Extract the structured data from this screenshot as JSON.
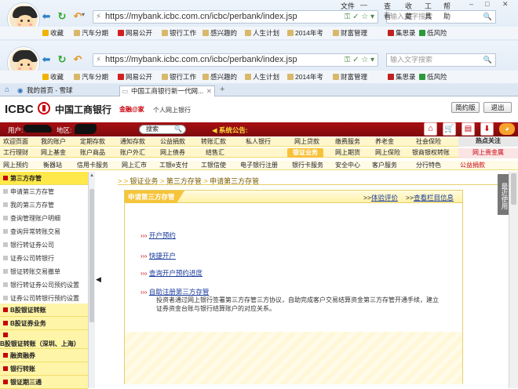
{
  "browser": {
    "url": "https://mybank.icbc.com.cn/icbc/perbank/index.jsp",
    "search_placeholder": "输入文字搜索",
    "menu": [
      "文件",
      "查看",
      "收藏",
      "工具",
      "帮助"
    ],
    "favorites": [
      "收藏",
      "汽车分期",
      "网易公开",
      "银行工作",
      "感兴趣的",
      "人生计划",
      "2014年考",
      "财富管理",
      "集思录",
      "低风险"
    ],
    "tabs": [
      "我的首页 - 雪球",
      "中国工商银行新一代网..."
    ],
    "new_tab": "+"
  },
  "icbc": {
    "logo_en": "ICBC",
    "logo_cn": "中国工商银行",
    "brand": "金融@家",
    "sub_brand": "个人网上银行",
    "btn_simple": "简约版",
    "btn_logout": "退出",
    "user_label": "用户:",
    "region_label": "地区:",
    "search_btn": "搜索",
    "notice_label": "系统公告:",
    "hot_label": "热点关注"
  },
  "nav": {
    "row1": [
      "欢迎页面",
      "我的账户",
      "定期存款",
      "通知存款",
      "公益捐款",
      "转账汇款",
      "私人银行",
      "网上贷款",
      "缴费服务",
      "养老金",
      "社会保险"
    ],
    "row2": [
      "工行理财",
      "网上基金",
      "账户商品",
      "账户外汇",
      "网上债券",
      "结售汇",
      "银证业务",
      "网上期货",
      "网上保险",
      "银商银权转账",
      "网上贵金属"
    ],
    "row3": [
      "网上预约",
      "衡器站",
      "信用卡服务",
      "网上汇市",
      "工银e支付",
      "工银信使",
      "电子银行注册",
      "银行卡服务",
      "安全中心",
      "客户服务",
      "分行特色",
      "公益捐款"
    ],
    "active_row2": "银证业务"
  },
  "sidebar": {
    "group1": "第三方存管",
    "items": [
      "申请第三方存管",
      "我的第三方存管",
      "查询管理账户明细",
      "查询异常转账交易",
      "银行转证券公司",
      "证券公司转银行",
      "银证转账交易撤单",
      "银行转证券公司预约设置",
      "证券公司转银行预约设置"
    ],
    "groups": [
      "B股银证转账",
      "B股证券业务",
      "B股银证转账（深圳、上海）",
      "融资融券",
      "银行转账",
      "银证期三通"
    ]
  },
  "main": {
    "breadcrumb": [
      "银证业务",
      "第三方存管",
      "申请第三方存管"
    ],
    "card_title": "申请第三方存管",
    "link_feedback": "体验评价",
    "link_info": "查看栏目信息",
    "links": [
      "开户预约",
      "快捷开户",
      "查询开户预约进度",
      "自助注册第三方存管"
    ],
    "desc": "投资者通过网上银行签署第三方存管三方协议，自助完成客户交易结算资金第三方存管开通手续，建立证券资金台账与银行结算账户的对应关系。"
  },
  "right_tab": "最近使用",
  "colors": {
    "icbc_red": "#c7000b",
    "nav_yellow": "#f7e38a",
    "link_blue": "#1a3c9c"
  }
}
